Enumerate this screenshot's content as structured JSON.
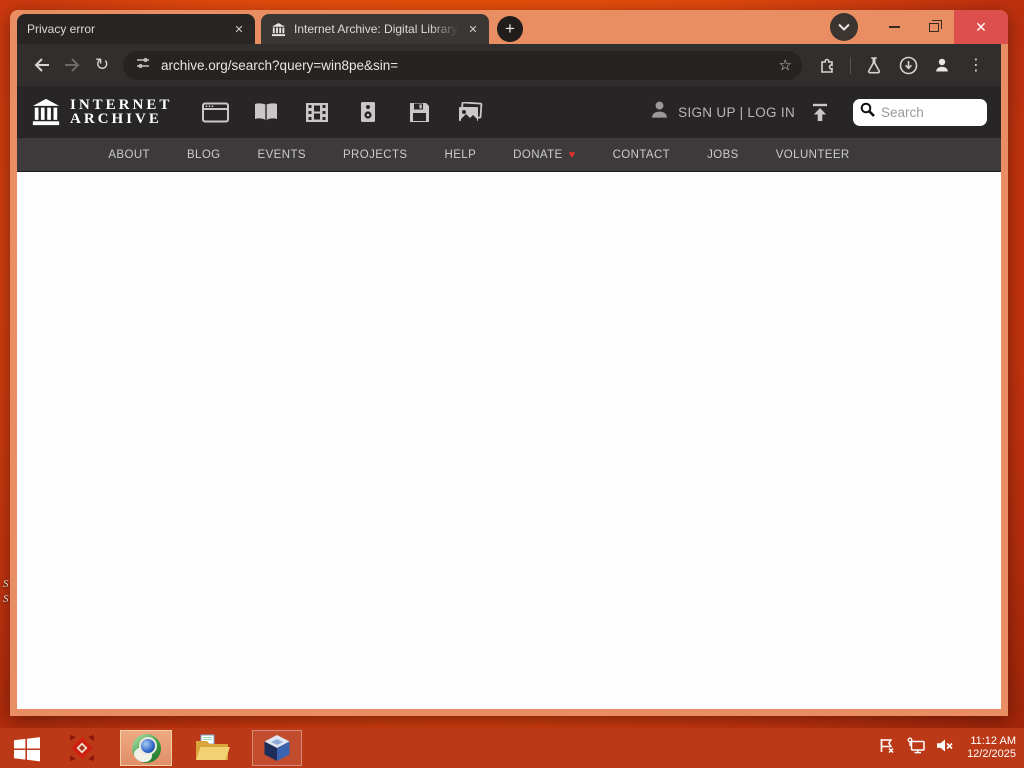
{
  "colors": {
    "titlebar": "#e98e62",
    "toolbar": "#312f2e",
    "tab_active": "#3a3734",
    "tab_inactive": "#282524",
    "close_button": "#dd4f4d",
    "ia_header": "#272525",
    "ia_nav_bar": "#3c3a3a",
    "page_content": "#fdfdfd",
    "taskbar": "#bb3917",
    "donate_heart": "#e0312e",
    "desktop_orange": "#e64a0e"
  },
  "glyphs": {
    "plus": "+",
    "close": "✕",
    "kebab": "⋮",
    "star": "☆",
    "reload": "↻",
    "heart": "♥"
  },
  "browser": {
    "tabs": [
      {
        "title": "Privacy error"
      },
      {
        "title": "Internet Archive: Digital Library"
      }
    ],
    "url": "archive.org/search?query=win8pe&sin="
  },
  "ia": {
    "logo_line1": "INTERNET",
    "logo_line2": "ARCHIVE",
    "signup_login": "SIGN UP | LOG IN",
    "search_placeholder": "Search",
    "nav": [
      "ABOUT",
      "BLOG",
      "EVENTS",
      "PROJECTS",
      "HELP",
      "DONATE",
      "CONTACT",
      "JOBS",
      "VOLUNTEER"
    ]
  },
  "taskbar": {
    "time": "11:12 AM",
    "date": "12/2/2025"
  },
  "desktop": {
    "fragments": [
      "S",
      "S"
    ]
  }
}
